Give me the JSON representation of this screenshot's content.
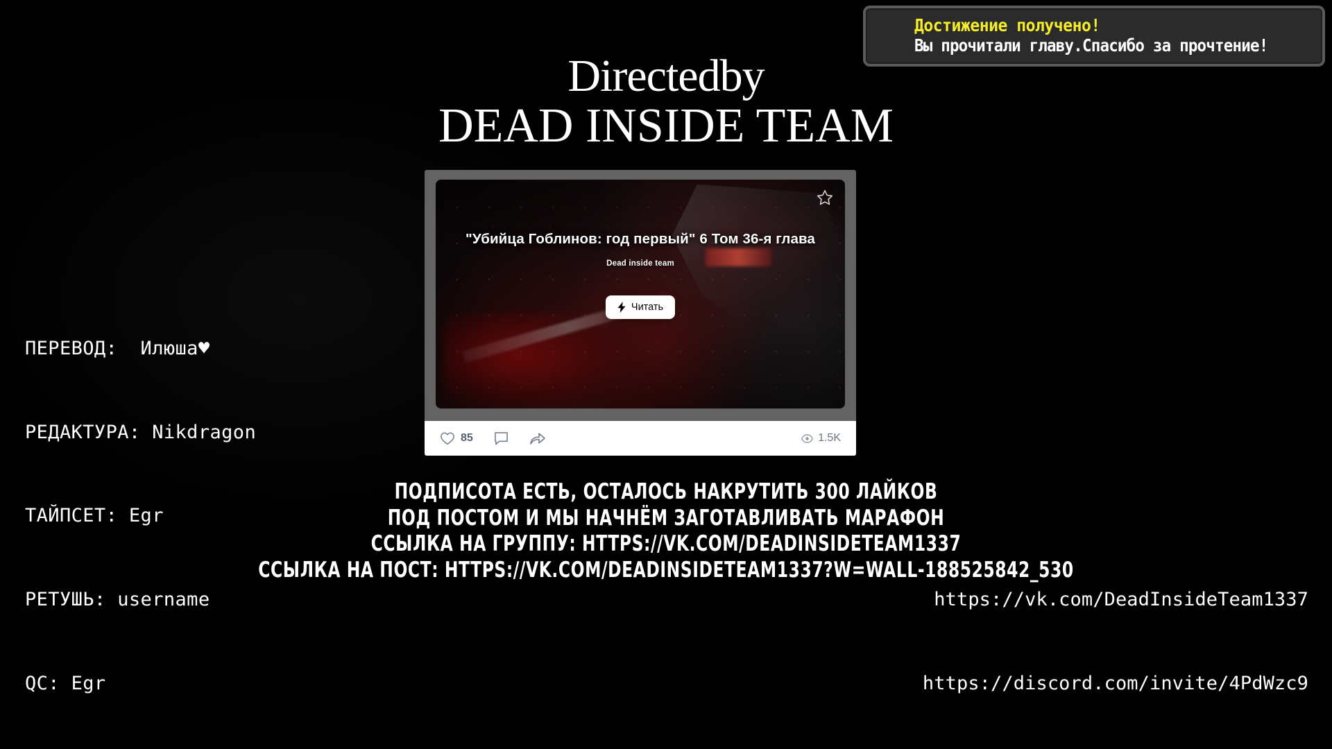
{
  "achievement": {
    "title": "Достижение получено!",
    "message": "Вы прочитали главу.Спасибо за прочтение!",
    "title_color": "#f5ec2a",
    "message_color": "#ffffff",
    "panel_bg": "#2b2b2b",
    "panel_border": "#5a5a5a"
  },
  "header": {
    "line1": "Directedby",
    "line2": "DEAD INSIDE TEAM"
  },
  "vk_post": {
    "title": "\"Убийца Гоблинов: год первый\" 6 Том 36-я глава",
    "subtitle": "Dead inside team",
    "read_button": "Читать",
    "bolt_icon": "lightning-bolt-icon",
    "star_icon": "star-outline-icon",
    "stats": {
      "likes": "85",
      "likes_icon": "heart-icon",
      "comments_icon": "comment-icon",
      "share_icon": "share-arrow-icon",
      "views": "1.5K",
      "views_icon": "eye-icon"
    },
    "card_bg": "#636363",
    "stats_bar_bg": "#ffffff",
    "button_bg": "#ffffff"
  },
  "promo": {
    "line1": "Подписота есть, осталось накрутить 300 лайков",
    "line2": "под постом и мы начнём заготавливать марафон",
    "line3": "Ссылка на группу:  https://vk.com/deadinsideteam1337",
    "line4": "Ссылка на пост:  https://vk.com/deadinsideteam1337?w=wall-188525842_530"
  },
  "credits": {
    "translation": "ПЕРЕВОД:  Илюша♥",
    "editing": "РЕДАКТУРА: Nikdragon",
    "typeset": "ТАЙПСЕТ: Egr",
    "retouch": "РЕТУШЬ: username",
    "qc": "QC: Egr"
  },
  "links": {
    "vk": "https://vk.com/DeadInsideTeam1337",
    "discord": "https://discord.com/invite/4PdWzc9"
  }
}
